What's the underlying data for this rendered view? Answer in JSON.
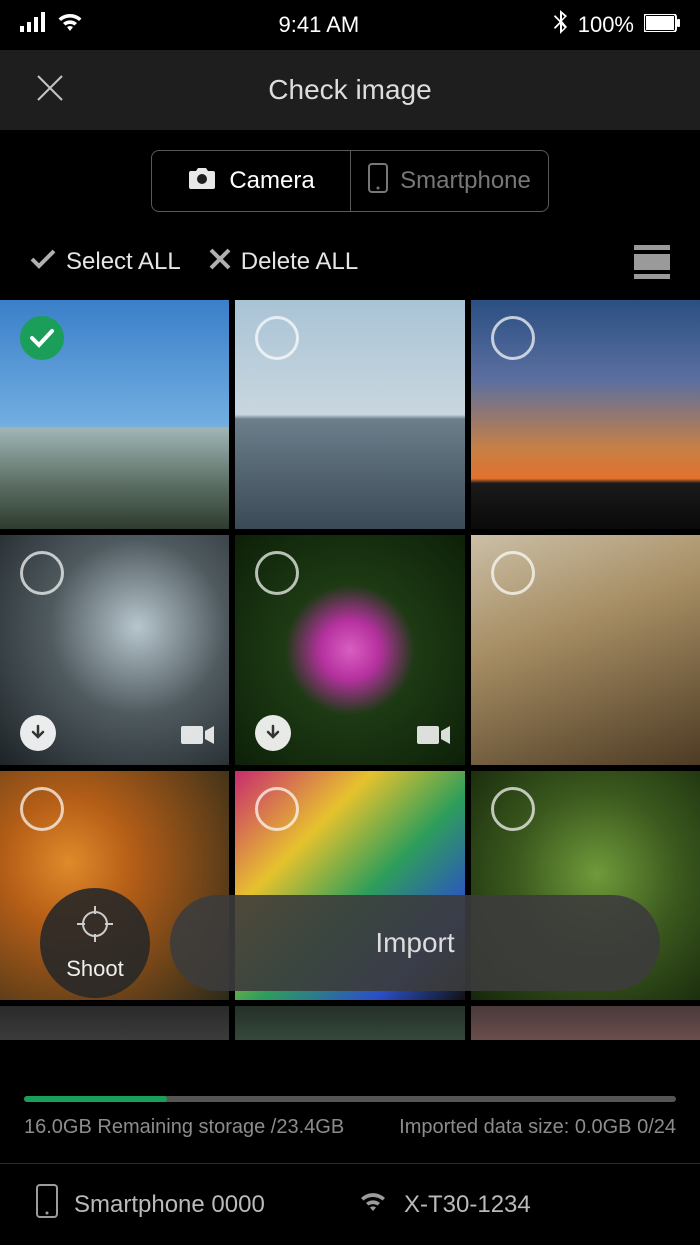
{
  "status": {
    "time": "9:41 AM",
    "battery": "100%"
  },
  "header": {
    "title": "Check image"
  },
  "tabs": {
    "camera": "Camera",
    "smartphone": "Smartphone"
  },
  "actions": {
    "select_all": "Select ALL",
    "delete_all": "Delete ALL"
  },
  "floating": {
    "shoot": "Shoot",
    "import": "Import"
  },
  "storage": {
    "progress_percent": 22,
    "remaining_text": "16.0GB Remaining storage /23.4GB",
    "imported_text": "Imported data size: 0.0GB 0/24"
  },
  "devices": {
    "phone": "Smartphone 0000",
    "camera": "X-T30-1234"
  },
  "thumbs": [
    {
      "selected": true,
      "download": false,
      "video": false
    },
    {
      "selected": false,
      "download": false,
      "video": false
    },
    {
      "selected": false,
      "download": false,
      "video": false
    },
    {
      "selected": false,
      "download": true,
      "video": true
    },
    {
      "selected": false,
      "download": true,
      "video": true
    },
    {
      "selected": false,
      "download": false,
      "video": false
    },
    {
      "selected": false,
      "download": false,
      "video": false
    },
    {
      "selected": false,
      "download": false,
      "video": false
    },
    {
      "selected": false,
      "download": false,
      "video": false
    }
  ]
}
